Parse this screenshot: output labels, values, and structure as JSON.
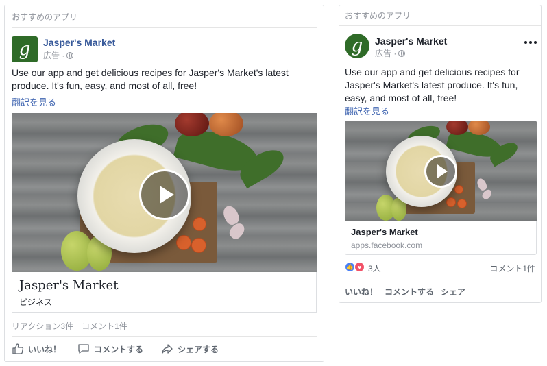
{
  "desktop": {
    "section_header": "おすすめのアプリ",
    "page_name": "Jasper's Market",
    "avatar_letter": "g",
    "sponsored_label": "広告 ·",
    "post_text": "Use our app and get delicious recipes for Jasper's Market's latest produce. It's fun, easy, and most of all, free!",
    "translate_label": "翻訳を見る",
    "link_title": "Jasper's Market",
    "link_subtitle": "ビジネス",
    "stats_text": "リアクション3件　コメント1件",
    "actions": {
      "like": "いいね！",
      "comment": "コメントする",
      "share": "シェアする"
    },
    "icons": [
      "play-icon",
      "globe-icon",
      "like-icon",
      "comment-icon",
      "share-icon"
    ]
  },
  "mobile": {
    "section_header": "おすすめのアプリ",
    "page_name": "Jasper's Market",
    "avatar_letter": "g",
    "sponsored_label": "広告 ·",
    "post_text": "Use our app and get delicious recipes for Jasper's Market's latest produce. It's fun, easy, and most of all, free!",
    "translate_label": "翻訳を見る",
    "link_title": "Jasper's Market",
    "link_domain": "apps.facebook.com",
    "reaction_count": "3人",
    "comment_count": "コメント1件",
    "actions": {
      "like": "いいね！",
      "comment": "コメントする",
      "share": "シェア"
    },
    "icons": [
      "more-icon",
      "play-icon",
      "like-reaction-icon",
      "love-reaction-icon"
    ]
  },
  "colors": {
    "brand_green": "#2f6b28",
    "link_blue": "#365899",
    "muted_text": "#90949c",
    "like_blue": "#4a80f5",
    "love_red": "#f25268"
  }
}
